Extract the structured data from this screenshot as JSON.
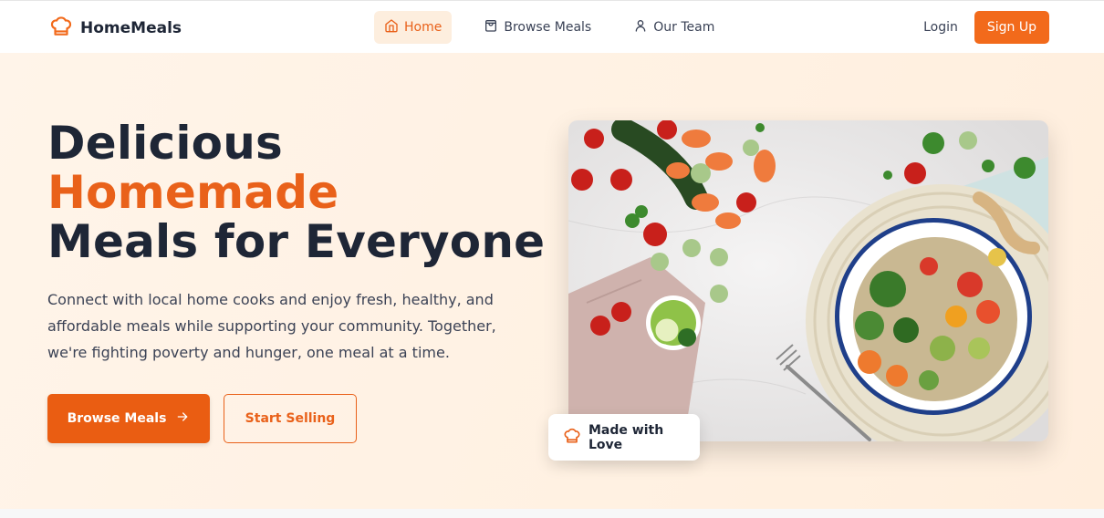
{
  "brand": {
    "name": "HomeMeals",
    "icon": "chef-hat-icon",
    "accent": "#f26a1b"
  },
  "nav": {
    "links": [
      {
        "label": "Home",
        "icon": "home-icon",
        "active": true
      },
      {
        "label": "Browse Meals",
        "icon": "shopping-bag-icon",
        "active": false
      },
      {
        "label": "Our Team",
        "icon": "user-icon",
        "active": false
      }
    ],
    "login_label": "Login",
    "signup_label": "Sign Up"
  },
  "hero": {
    "title_line1": "Delicious",
    "title_line2": "Homemade",
    "title_line3": "Meals for Everyone",
    "description": "Connect with local home cooks and enjoy fresh, healthy, and affordable meals while supporting your community. Together, we're fighting poverty and hunger, one meal at a time.",
    "primary_button": "Browse Meals",
    "secondary_button": "Start Selling",
    "badge_label": "Made with Love"
  },
  "colors": {
    "primary": "#ea5d12",
    "title": "#1e2636",
    "hero_bg": "#fff4e9"
  }
}
